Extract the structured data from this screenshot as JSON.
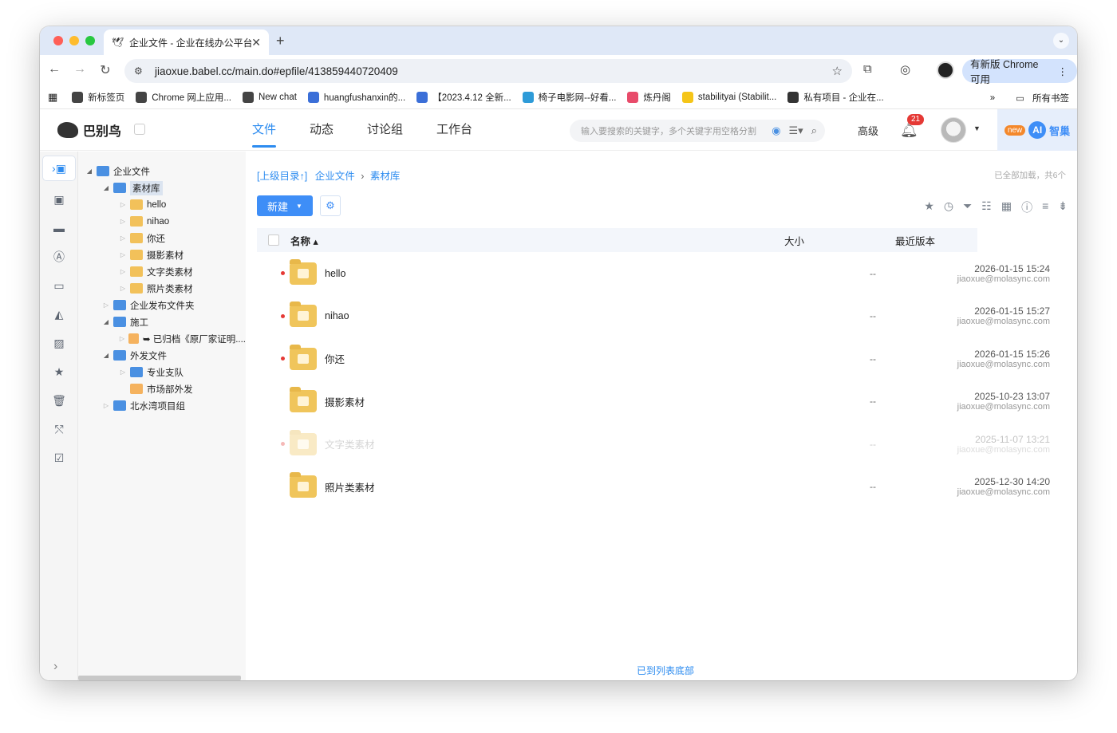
{
  "browser": {
    "tab_title": "企业文件 - 企业在线办公平台",
    "url": "jiaoxue.babel.cc/main.do#epfile/413859440720409",
    "update_label": "有新版 Chrome 可用",
    "bookmarks": [
      {
        "label": "新标签页",
        "color": "#444444"
      },
      {
        "label": "Chrome 网上应用...",
        "color": "#444444"
      },
      {
        "label": "New chat",
        "color": "#444444"
      },
      {
        "label": "huangfushanxin的...",
        "color": "#3b6fd8"
      },
      {
        "label": "【2023.4.12 全新...",
        "color": "#3b6fd8"
      },
      {
        "label": "椅子电影网--好看...",
        "color": "#2e9bd8"
      },
      {
        "label": "炼丹阁",
        "color": "#e84b6a"
      },
      {
        "label": "stabilityai (Stabilit...",
        "color": "#f5c518"
      },
      {
        "label": "私有项目 - 企业在...",
        "color": "#333333"
      }
    ],
    "all_bookmarks": "所有书签"
  },
  "app": {
    "logo_text": "巴别鸟",
    "nav": [
      "文件",
      "动态",
      "讨论组",
      "工作台"
    ],
    "active_nav": "文件",
    "search_placeholder": "输入要搜索的关键字，多个关键字用空格分割",
    "advanced": "高级",
    "notification_count": "21",
    "ai_new": "new",
    "ai_logo": "AI",
    "ai_label": "智巢"
  },
  "tree": [
    {
      "label": "企业文件",
      "indent": 0,
      "arrow": "open",
      "icon": "blue"
    },
    {
      "label": "素材库",
      "indent": 1,
      "arrow": "open",
      "icon": "blue",
      "selected": true
    },
    {
      "label": "hello",
      "indent": 2,
      "arrow": "closed",
      "icon": "yellow"
    },
    {
      "label": "nihao",
      "indent": 2,
      "arrow": "closed",
      "icon": "yellow"
    },
    {
      "label": "你还",
      "indent": 2,
      "arrow": "closed",
      "icon": "yellow"
    },
    {
      "label": "摄影素材",
      "indent": 2,
      "arrow": "closed",
      "icon": "yellow"
    },
    {
      "label": "文字类素材",
      "indent": 2,
      "arrow": "closed",
      "icon": "yellow"
    },
    {
      "label": "照片类素材",
      "indent": 2,
      "arrow": "closed",
      "icon": "yellow"
    },
    {
      "label": "企业发布文件夹",
      "indent": 1,
      "arrow": "closed",
      "icon": "blue"
    },
    {
      "label": "施工",
      "indent": 1,
      "arrow": "open",
      "icon": "blue"
    },
    {
      "label": "➥ 已归档《原厂家证明....",
      "indent": 2,
      "arrow": "closed",
      "icon": "orange"
    },
    {
      "label": "外发文件",
      "indent": 1,
      "arrow": "open",
      "icon": "blue"
    },
    {
      "label": "专业支队",
      "indent": 2,
      "arrow": "closed",
      "icon": "blue"
    },
    {
      "label": "市场部外发",
      "indent": 2,
      "arrow": "none",
      "icon": "orange"
    },
    {
      "label": "北水湾项目组",
      "indent": 1,
      "arrow": "closed",
      "icon": "blue"
    }
  ],
  "content": {
    "breadcrumb_up": "[上级目录↑]",
    "breadcrumb_root": "企业文件",
    "breadcrumb_current": "素材库",
    "loaded_text": "已全部加载，共6个",
    "new_button": "新建",
    "columns": {
      "name": "名称",
      "size": "大小",
      "version": "最近版本"
    },
    "files": [
      {
        "name": "hello",
        "size": "--",
        "date": "2026-01-15 15:24",
        "by": "jiaoxue@molasync.com",
        "dot": true,
        "faded": false
      },
      {
        "name": "nihao",
        "size": "--",
        "date": "2026-01-15 15:27",
        "by": "jiaoxue@molasync.com",
        "dot": true,
        "faded": false
      },
      {
        "name": "你还",
        "size": "--",
        "date": "2026-01-15 15:26",
        "by": "jiaoxue@molasync.com",
        "dot": true,
        "faded": false
      },
      {
        "name": "摄影素材",
        "size": "--",
        "date": "2025-10-23 13:07",
        "by": "jiaoxue@molasync.com",
        "dot": false,
        "faded": false
      },
      {
        "name": "文字类素材",
        "size": "--",
        "date": "2025-11-07 13:21",
        "by": "jiaoxue@molasync.com",
        "dot": true,
        "faded": true
      },
      {
        "name": "照片类素材",
        "size": "--",
        "date": "2025-12-30 14:20",
        "by": "jiaoxue@molasync.com",
        "dot": false,
        "faded": false
      }
    ],
    "bottom_note": "已到列表底部"
  }
}
